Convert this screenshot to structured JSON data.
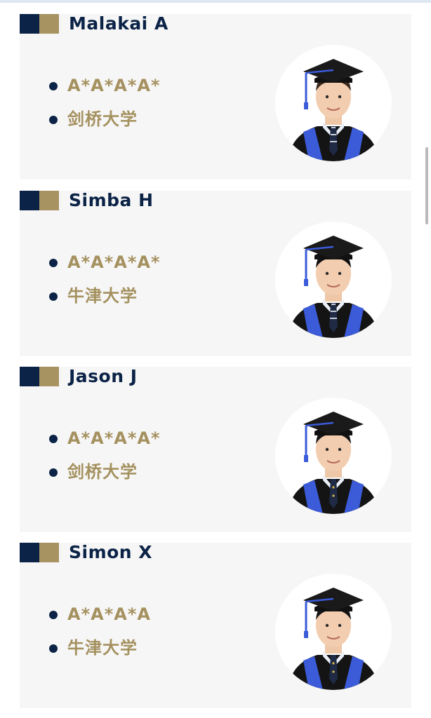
{
  "students": [
    {
      "name": "Malakai A",
      "grade": "A*A*A*A*",
      "university": "剑桥大学",
      "hair": "#3d2a1e",
      "tie": "stripe"
    },
    {
      "name": "Simba H",
      "grade": "A*A*A*A*",
      "university": "牛津大学",
      "hair": "#101010",
      "tie": "stripe"
    },
    {
      "name": "Jason J",
      "grade": "A*A*A*A*",
      "university": "剑桥大学",
      "hair": "#151515",
      "tie": "dot"
    },
    {
      "name": "Simon X",
      "grade": "A*A*A*A",
      "university": "牛津大学",
      "hair": "#151515",
      "tie": "dot"
    }
  ],
  "colors": {
    "navy": "#0b2346",
    "gold": "#a5915f",
    "card_bg": "#f6f6f6",
    "stole_blue": "#3b5bd8"
  },
  "icons": {
    "badge": "navy-gold-square-badge-icon",
    "bullet": "bullet-dot-icon",
    "portrait": "graduate-portrait-icon"
  }
}
